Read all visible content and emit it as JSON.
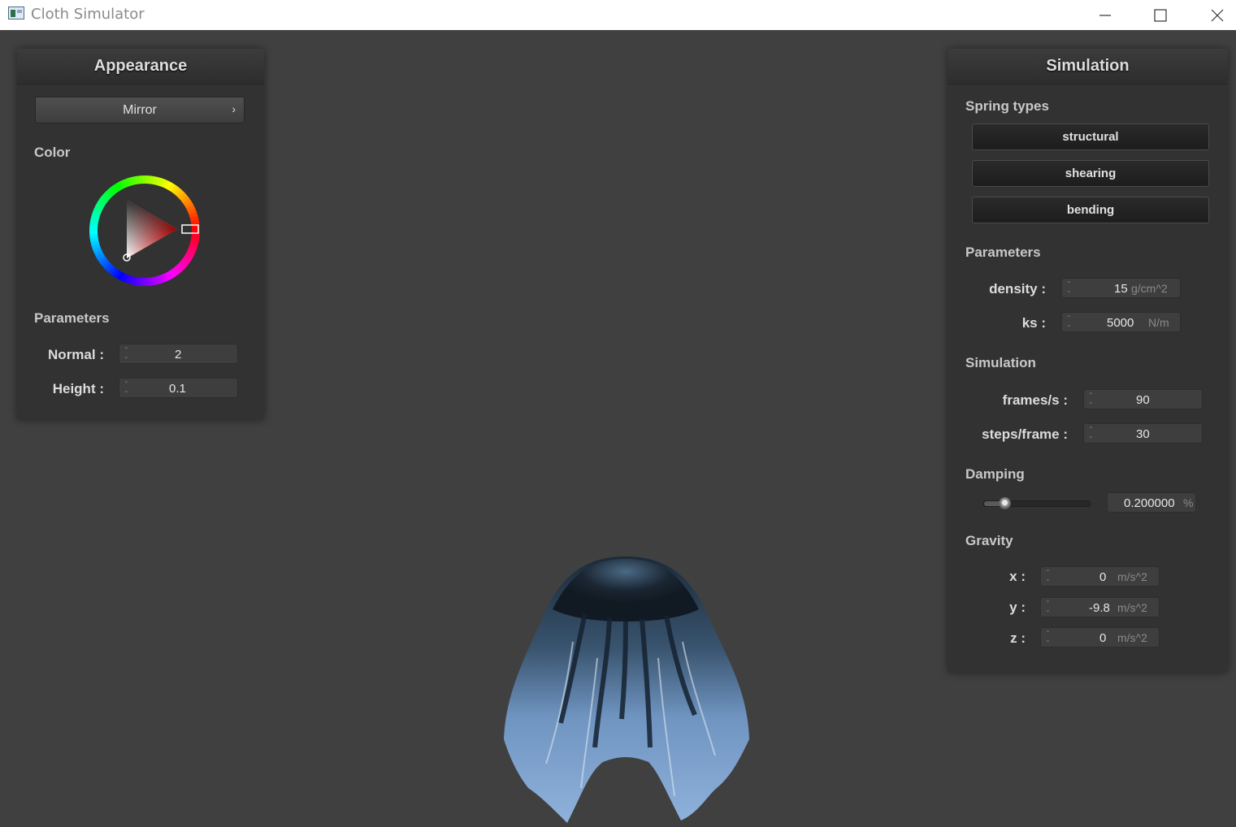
{
  "window": {
    "title": "Cloth Simulator"
  },
  "appearance": {
    "title": "Appearance",
    "shader": "Mirror",
    "color_label": "Color",
    "selected_color": "#ff0000",
    "parameters_label": "Parameters",
    "normal": {
      "label": "Normal :",
      "value": "2"
    },
    "height": {
      "label": "Height :",
      "value": "0.1"
    }
  },
  "simulation": {
    "title": "Simulation",
    "spring_types_label": "Spring types",
    "spring_types": [
      "structural",
      "shearing",
      "bending"
    ],
    "parameters_label": "Parameters",
    "density": {
      "label": "density :",
      "value": "15",
      "unit": "g/cm^2"
    },
    "ks": {
      "label": "ks :",
      "value": "5000",
      "unit": "N/m"
    },
    "simulation_label": "Simulation",
    "fps": {
      "label": "frames/s :",
      "value": "90"
    },
    "steps": {
      "label": "steps/frame :",
      "value": "30"
    },
    "damping_label": "Damping",
    "damping": {
      "value": "0.200000",
      "unit": "%",
      "slider_fraction": 0.2
    },
    "gravity_label": "Gravity",
    "gravity_x": {
      "label": "x :",
      "value": "0",
      "unit": "m/s^2"
    },
    "gravity_y": {
      "label": "y :",
      "value": "-9.8",
      "unit": "m/s^2"
    },
    "gravity_z": {
      "label": "z :",
      "value": "0",
      "unit": "m/s^2"
    }
  }
}
